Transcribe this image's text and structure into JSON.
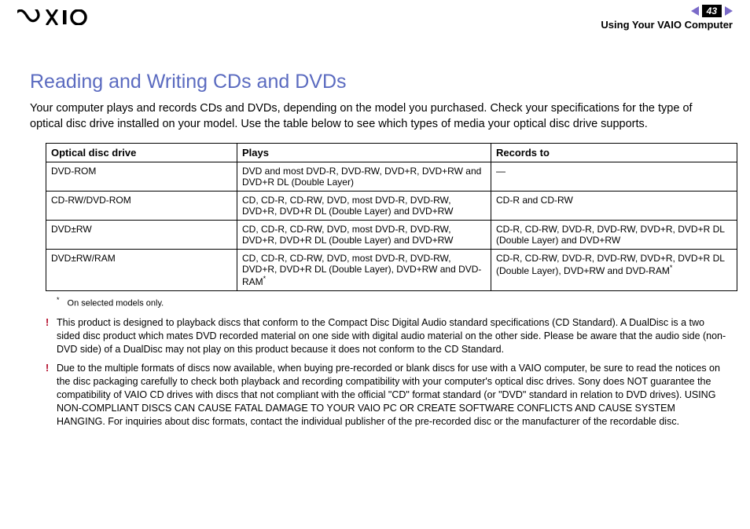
{
  "header": {
    "page_number": "43",
    "section_title": "Using Your VAIO Computer"
  },
  "title": "Reading and Writing CDs and DVDs",
  "intro": "Your computer plays and records CDs and DVDs, depending on the model you purchased. Check your specifications for the type of optical disc drive installed on your model. Use the table below to see which types of media your optical disc drive supports.",
  "table": {
    "headers": {
      "c1": "Optical disc drive",
      "c2": "Plays",
      "c3": "Records to"
    },
    "rows": [
      {
        "c1": "DVD-ROM",
        "c2": "DVD and most DVD-R, DVD-RW, DVD+R, DVD+RW and DVD+R DL (Double Layer)",
        "c3": "—"
      },
      {
        "c1": "CD-RW/DVD-ROM",
        "c2": "CD, CD-R, CD-RW, DVD, most DVD-R, DVD-RW, DVD+R, DVD+R DL (Double Layer) and DVD+RW",
        "c3": "CD-R and CD-RW"
      },
      {
        "c1": "DVD±RW",
        "c2": "CD, CD-R, CD-RW, DVD, most DVD-R, DVD-RW, DVD+R, DVD+R DL (Double Layer) and DVD+RW",
        "c3": "CD-R, CD-RW, DVD-R, DVD-RW, DVD+R, DVD+R DL (Double Layer) and DVD+RW"
      },
      {
        "c1": "DVD±RW/RAM",
        "c2": "CD, CD-R, CD-RW, DVD, most DVD-R, DVD-RW, DVD+R, DVD+R DL (Double Layer), DVD+RW and DVD-RAM",
        "c2sup": "*",
        "c3": "CD-R, CD-RW, DVD-R, DVD-RW, DVD+R, DVD+R DL (Double Layer), DVD+RW and DVD-RAM",
        "c3sup": "*"
      }
    ]
  },
  "footnote": {
    "mark": "*",
    "text": "On selected models only."
  },
  "warnings": [
    "This product is designed to playback discs that conform to the Compact Disc Digital Audio standard specifications (CD Standard). A DualDisc is a two sided disc product which mates DVD recorded material on one side with digital audio material on the other side. Please be aware that the audio side (non-DVD side) of a DualDisc may not play on this product because it does not conform to the CD Standard.",
    "Due to the multiple formats of discs now available, when buying pre-recorded or blank discs for use with a VAIO computer, be sure to read the notices on the disc packaging carefully to check both playback and recording compatibility with your computer's optical disc drives. Sony does NOT guarantee the compatibility of VAIO CD drives with discs that not compliant with the official \"CD\" format standard (or \"DVD\" standard in relation to DVD drives). USING NON-COMPLIANT DISCS CAN CAUSE FATAL DAMAGE TO YOUR VAIO PC OR CREATE SOFTWARE CONFLICTS AND CAUSE SYSTEM HANGING. For inquiries about disc formats, contact the individual publisher of the pre-recorded disc or the manufacturer of the recordable disc."
  ],
  "bang": "!"
}
